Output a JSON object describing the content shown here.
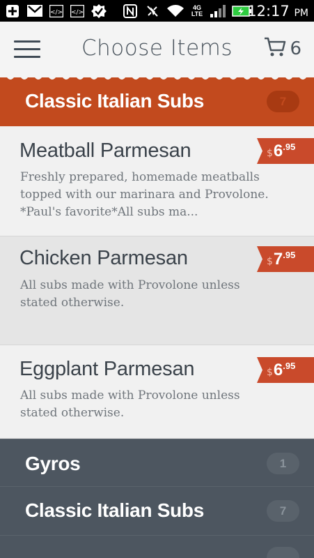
{
  "status_bar": {
    "time": "12:17",
    "ampm": "PM",
    "network": "4G LTE",
    "icons": [
      "add-icon",
      "gmail-icon",
      "code-icon",
      "code-icon",
      "check-icon",
      "nfc-icon",
      "mute-icon",
      "wifi-icon",
      "signal-icon",
      "battery-charging-icon"
    ]
  },
  "header": {
    "menu_icon": "hamburger-icon",
    "title": "Choose Items",
    "cart_icon": "cart-icon",
    "cart_count": "6"
  },
  "colors": {
    "accent": "#c24a1e",
    "price_tag": "#c94a2b",
    "dark_category": "#4d5660",
    "text": "#3a424a"
  },
  "active_category": {
    "title": "Classic Italian Subs",
    "count": "7"
  },
  "items": [
    {
      "name": "Meatball Parmesan",
      "description": "Freshly prepared, homemade meatballs topped with our marinara and Provolone. *Paul's favorite*All subs ma...",
      "currency": "$",
      "dollars": "6",
      "cents": ".95"
    },
    {
      "name": "Chicken Parmesan",
      "description": "All subs made with Provolone unless stated otherwise.",
      "currency": "$",
      "dollars": "7",
      "cents": ".95"
    },
    {
      "name": "Eggplant Parmesan",
      "description": "All subs made with Provolone unless stated otherwise.",
      "currency": "$",
      "dollars": "6",
      "cents": ".95"
    }
  ],
  "other_categories": [
    {
      "title": "Gyros",
      "count": "1"
    },
    {
      "title": "Classic Italian Subs",
      "count": "7"
    },
    {
      "title": "",
      "count": ""
    }
  ]
}
